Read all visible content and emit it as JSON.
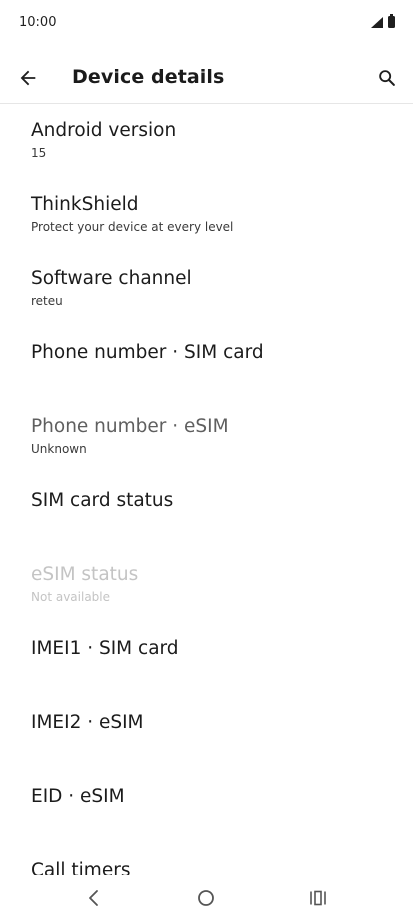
{
  "status_bar": {
    "time": "10:00"
  },
  "app_bar": {
    "title": "Device details"
  },
  "items": [
    {
      "title": "Android version",
      "subtitle": "15",
      "state": "normal"
    },
    {
      "title": "ThinkShield",
      "subtitle": "Protect your device at every level",
      "state": "normal"
    },
    {
      "title": "Software channel",
      "subtitle": "reteu",
      "state": "normal"
    },
    {
      "title": "Phone number · SIM card",
      "subtitle": "",
      "state": "normal"
    },
    {
      "title": "Phone number · eSIM",
      "subtitle": "Unknown",
      "state": "dim"
    },
    {
      "title": "SIM card status",
      "subtitle": "",
      "state": "normal"
    },
    {
      "title": "eSIM status",
      "subtitle": "Not available",
      "state": "disabled"
    },
    {
      "title": "IMEI1 · SIM card",
      "subtitle": "",
      "state": "normal"
    },
    {
      "title": "IMEI2 · eSIM",
      "subtitle": "",
      "state": "normal"
    },
    {
      "title": "EID · eSIM",
      "subtitle": "",
      "state": "normal"
    },
    {
      "title": "Call timers",
      "subtitle": "",
      "state": "normal"
    }
  ],
  "icons": {
    "back": "arrow-back-icon",
    "search": "search-icon",
    "nav_back": "nav-back-icon",
    "nav_home": "nav-home-icon",
    "nav_recents": "nav-recents-icon"
  }
}
